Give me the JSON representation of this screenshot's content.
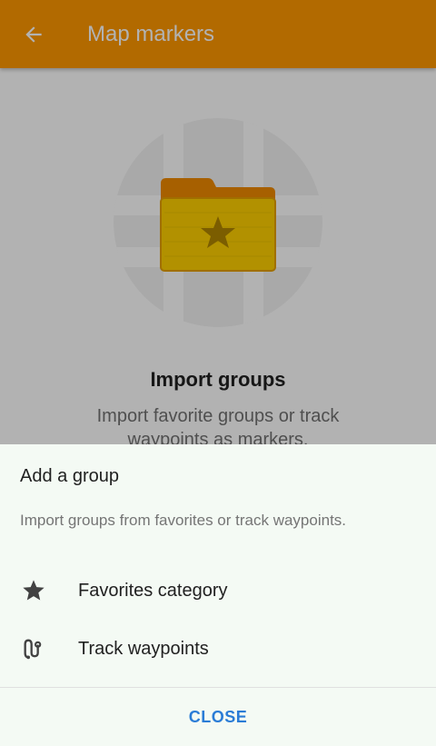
{
  "appbar": {
    "title": "Map markers",
    "back_icon": "arrow-back-icon",
    "color": "#ff9800"
  },
  "empty_state": {
    "illustration_icon": "folder-star-icon",
    "title": "Import groups",
    "description": "Import favorite groups or track waypoints as markers."
  },
  "sheet": {
    "title": "Add a group",
    "description": "Import groups from favorites or track waypoints.",
    "items": [
      {
        "label": "Favorites category",
        "icon": "star-icon"
      },
      {
        "label": "Track waypoints",
        "icon": "track-icon"
      }
    ],
    "close_label": "CLOSE",
    "background": "#f4faf4",
    "accent": "#2a7cd6"
  }
}
